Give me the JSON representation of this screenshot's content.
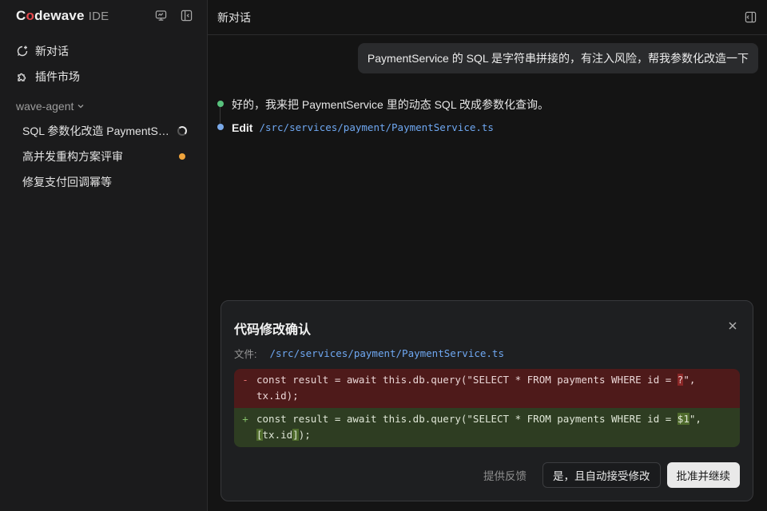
{
  "brand": {
    "name_pre": "C",
    "name_o": "o",
    "name_post": "dewave",
    "suffix": "IDE"
  },
  "sidebar": {
    "nav": [
      {
        "label": "新对话",
        "icon": "new-chat-icon"
      },
      {
        "label": "插件市场",
        "icon": "puzzle-icon"
      }
    ],
    "group_label": "wave-agent",
    "sessions": [
      {
        "label": "SQL 参数化改造 PaymentService",
        "status": "running"
      },
      {
        "label": "高并发重构方案评审",
        "status": "pending"
      },
      {
        "label": "修复支付回调幂等",
        "status": "idle"
      }
    ]
  },
  "main": {
    "title": "新对话",
    "user_message": "PaymentService 的 SQL 是字符串拼接的，有注入风险，帮我参数化改造一下",
    "assistant_text": "好的，我来把 PaymentService 里的动态 SQL 改成参数化查询。",
    "edit_label": "Edit",
    "edit_path": "/src/services/payment/PaymentService.ts"
  },
  "modal": {
    "title": "代码修改确认",
    "file_label": "文件:",
    "file_path": "/src/services/payment/PaymentService.ts",
    "diff": {
      "del_sign": "-",
      "del_before": "const result = await this.db.query(\"SELECT * FROM payments WHERE id = ",
      "del_hl": "?",
      "del_after": "\", tx.id);",
      "add_sign": "+",
      "add_before": "const result = await this.db.query(\"SELECT * FROM payments WHERE id = ",
      "add_hl": "$1",
      "add_mid": "\", ",
      "add_hl2": "[",
      "add_mid2": "tx.id",
      "add_hl3": "]",
      "add_after": ");"
    },
    "feedback_label": "提供反馈",
    "auto_accept_label": "是，且自动接受修改",
    "approve_label": "批准并继续"
  },
  "colors": {
    "accent_blue": "#6fa8f2",
    "status_green": "#58c27d",
    "status_orange": "#f0a43c",
    "brand_red": "#e5484d"
  }
}
